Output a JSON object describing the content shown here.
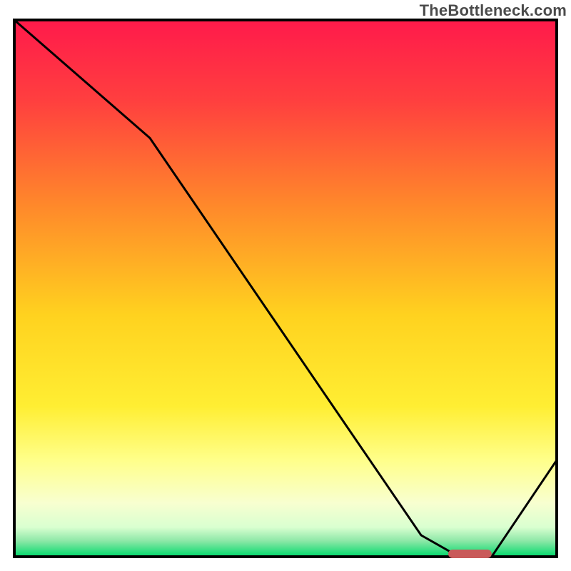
{
  "watermark": "TheBottleneck.com",
  "chart_data": {
    "type": "line",
    "title": "",
    "xlabel": "",
    "ylabel": "",
    "xlim": [
      0,
      100
    ],
    "ylim": [
      0,
      100
    ],
    "x": [
      0,
      25,
      75,
      82,
      88,
      100
    ],
    "values": [
      100,
      78,
      4,
      0,
      0,
      18
    ],
    "marker": {
      "x_start": 80,
      "x_end": 88,
      "y": 0
    },
    "gradient_stops": [
      {
        "offset": 0.0,
        "color": "#ff1a4b"
      },
      {
        "offset": 0.15,
        "color": "#ff3f3f"
      },
      {
        "offset": 0.35,
        "color": "#ff8a2a"
      },
      {
        "offset": 0.55,
        "color": "#ffd21f"
      },
      {
        "offset": 0.72,
        "color": "#ffee33"
      },
      {
        "offset": 0.82,
        "color": "#ffff8a"
      },
      {
        "offset": 0.9,
        "color": "#f8ffd0"
      },
      {
        "offset": 0.945,
        "color": "#d9ffd0"
      },
      {
        "offset": 0.97,
        "color": "#8fe8a8"
      },
      {
        "offset": 1.0,
        "color": "#00d96b"
      }
    ]
  }
}
